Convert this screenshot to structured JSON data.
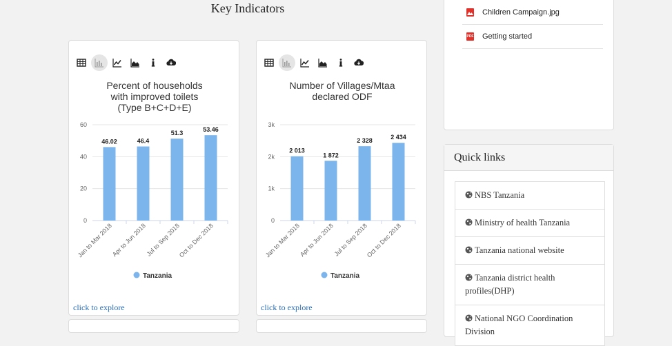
{
  "page": {
    "section_title": "Key Indicators"
  },
  "documents": [
    {
      "name": "Children Campaign.jpg",
      "type": "image"
    },
    {
      "name": "Getting started",
      "type": "pdf",
      "badge": "PDF"
    }
  ],
  "quick_links": {
    "title": "Quick links",
    "items": [
      "NBS Tanzania",
      "Ministry of health Tanzania",
      "Tanzania national website",
      "Tanzania district health profiles(DHP)",
      "National NGO Coordination Division"
    ]
  },
  "toolbar_icons": [
    "table-icon",
    "bar-chart-icon",
    "line-chart-icon",
    "area-chart-icon",
    "info-icon",
    "download-icon"
  ],
  "explore_label": "click to explore",
  "colors": {
    "bar": "#7cb5ec",
    "link": "#2a6db3",
    "file_icon": "#e0312b"
  },
  "chart_data": [
    {
      "type": "bar",
      "title": "Percent of households with improved toilets (Type B+C+D+E)",
      "title_lines": [
        "Percent of households",
        "with improved toilets",
        "(Type B+C+D+E)"
      ],
      "categories": [
        "Jan to Mar 2018",
        "Apr to Jun 2018",
        "Jul to Sep 2018",
        "Oct to Dec 2018"
      ],
      "series": [
        {
          "name": "Tanzania",
          "values": [
            46.02,
            46.4,
            51.3,
            53.46
          ]
        }
      ],
      "data_labels": [
        "46.02",
        "46.4",
        "51.3",
        "53.46"
      ],
      "yticks": [
        0,
        20,
        40,
        60
      ],
      "ytick_labels": [
        "0",
        "20",
        "40",
        "60"
      ],
      "ylim": [
        0,
        60
      ],
      "grid": true,
      "legend": "bottom-center"
    },
    {
      "type": "bar",
      "title": "Number of Villages/Mtaa declared ODF",
      "title_lines": [
        "Number of Villages/Mtaa",
        "declared ODF"
      ],
      "categories": [
        "Jan to Mar 2018",
        "Apr to Jun 2018",
        "Jul to Sep 2018",
        "Oct to Dec 2018"
      ],
      "series": [
        {
          "name": "Tanzania",
          "values": [
            2013,
            1872,
            2328,
            2434
          ]
        }
      ],
      "data_labels": [
        "2 013",
        "1 872",
        "2 328",
        "2 434"
      ],
      "yticks": [
        0,
        1000,
        2000,
        3000
      ],
      "ytick_labels": [
        "0",
        "1k",
        "2k",
        "3k"
      ],
      "ylim": [
        0,
        3000
      ],
      "grid": true,
      "legend": "bottom-center"
    }
  ]
}
